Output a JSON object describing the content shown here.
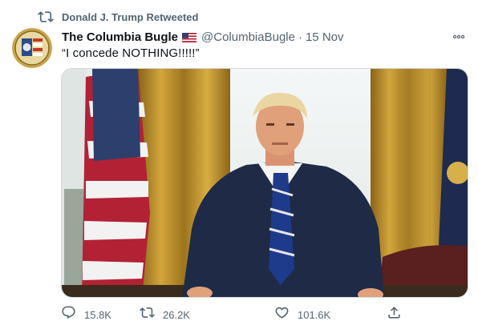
{
  "retweet_context": {
    "text": "Donald J. Trump Retweeted",
    "icon": "retweet-icon"
  },
  "author": {
    "display_name": "The Columbia Bugle",
    "flag_icon": "us-flag-icon",
    "handle": "@ColumbiaBugle",
    "separator": "·",
    "timestamp": "15 Nov"
  },
  "tweet": {
    "text": "“I concede NOTHING!!!!!”"
  },
  "actions": {
    "reply_count": "15.8K",
    "retweet_count": "26.2K",
    "like_count": "101.6K"
  },
  "colors": {
    "secondary_text": "#536471",
    "primary_text": "#0f1419",
    "border": "#cfd9de"
  }
}
